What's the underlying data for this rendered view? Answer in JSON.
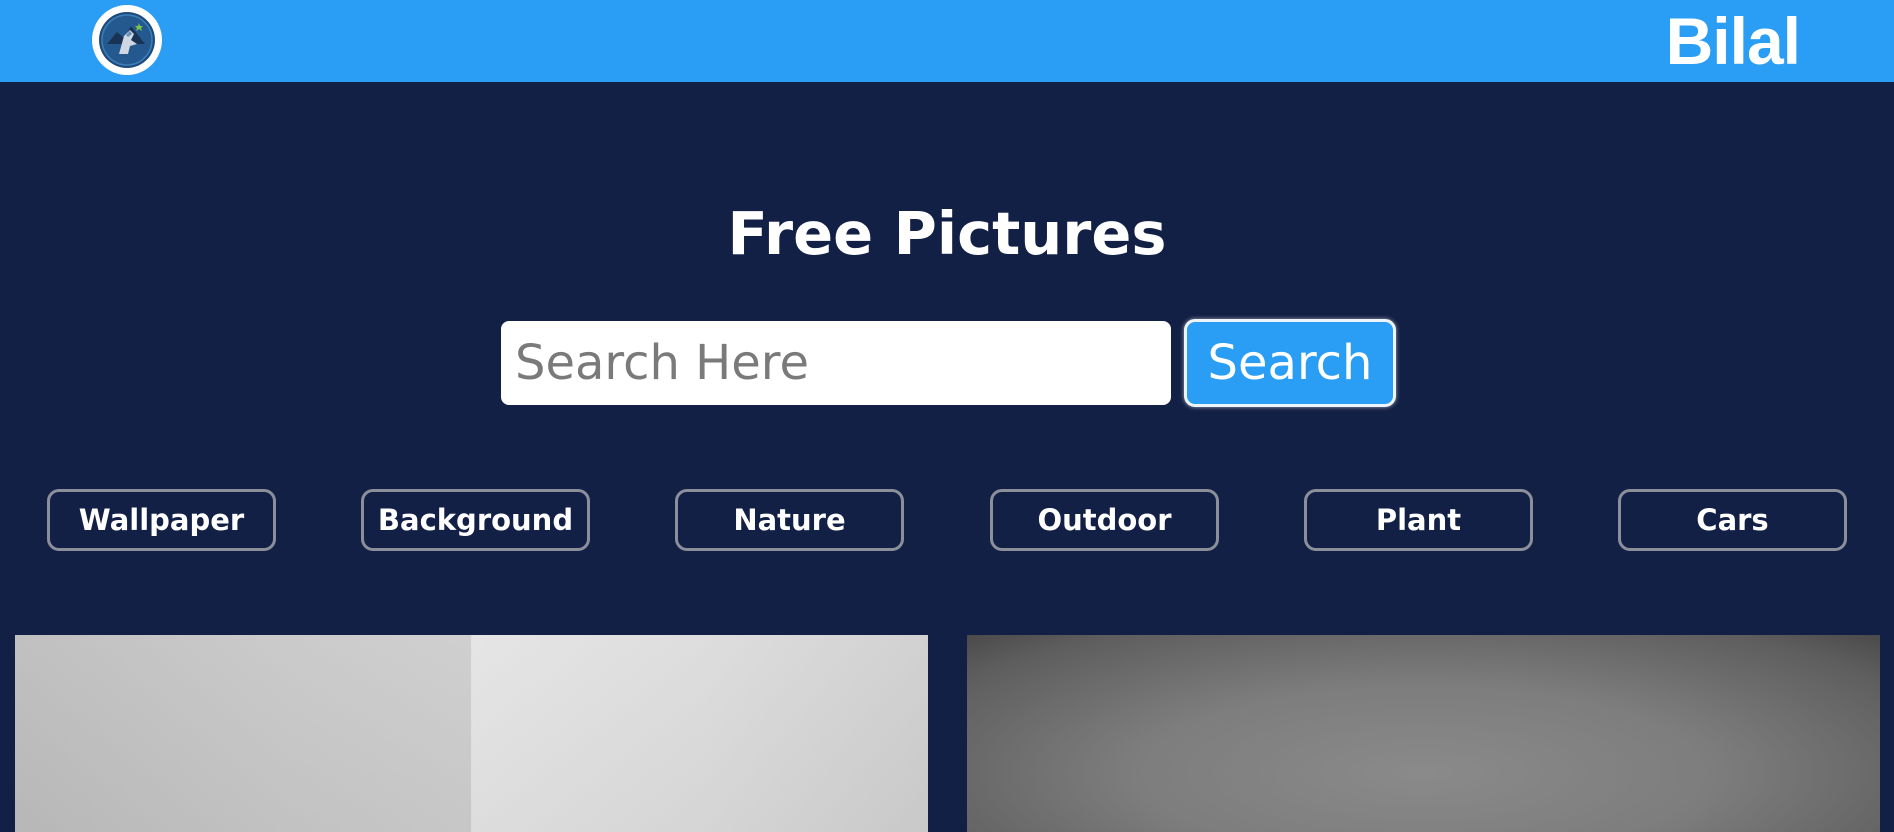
{
  "header": {
    "logo_icon": "team-logo-icon",
    "brand": "Bilal",
    "background_color": "#2a9df4"
  },
  "hero": {
    "title": "Free Pictures"
  },
  "search": {
    "placeholder": "Search Here",
    "value": "",
    "button_label": "Search"
  },
  "tags": [
    {
      "label": "Wallpaper"
    },
    {
      "label": "Background"
    },
    {
      "label": "Nature"
    },
    {
      "label": "Outdoor"
    },
    {
      "label": "Plant"
    },
    {
      "label": "Cars"
    }
  ],
  "colors": {
    "page_background": "#132046",
    "accent": "#2a9df4",
    "tag_border": "#8a8f99"
  }
}
